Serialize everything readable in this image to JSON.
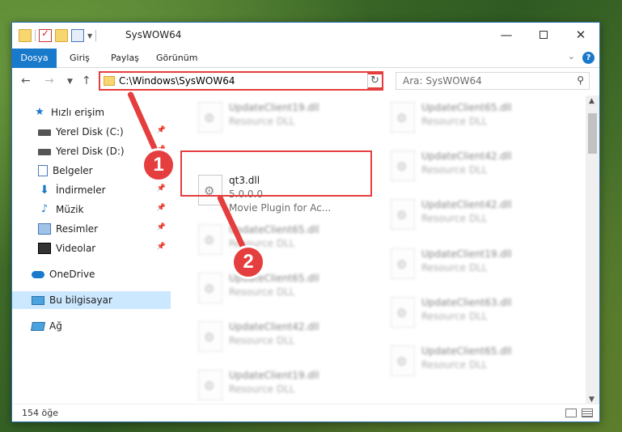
{
  "titlebar": {
    "title": "SysWOW64"
  },
  "ribbon": {
    "tabs": [
      "Dosya",
      "Giriş",
      "Paylaş",
      "Görünüm"
    ]
  },
  "address": {
    "path": "C:\\Windows\\SysWOW64",
    "search_placeholder": "Ara: SysWOW64"
  },
  "sidebar": {
    "items": [
      {
        "label": "Hızlı erişim",
        "icon": "star-icon"
      },
      {
        "label": "Yerel Disk (C:)",
        "icon": "drive-icon"
      },
      {
        "label": "Yerel Disk (D:)",
        "icon": "drive-icon"
      },
      {
        "label": "Belgeler",
        "icon": "documents-icon"
      },
      {
        "label": "İndirmeler",
        "icon": "downloads-icon"
      },
      {
        "label": "Müzik",
        "icon": "music-icon"
      },
      {
        "label": "Resimler",
        "icon": "pictures-icon"
      },
      {
        "label": "Videolar",
        "icon": "videos-icon"
      },
      {
        "label": "OneDrive",
        "icon": "onedrive-icon"
      },
      {
        "label": "Bu bilgisayar",
        "icon": "computer-icon"
      },
      {
        "label": "Ağ",
        "icon": "network-icon"
      }
    ]
  },
  "files": {
    "left": [
      {
        "name": "UpdateClient19.dll",
        "desc": "Resource DLL"
      },
      {
        "name": "UpdateClient65.dll",
        "desc": "Resource DLL"
      },
      {
        "name": "UpdateClient65.dll",
        "desc": "Resource DLL"
      },
      {
        "name": "UpdateClient42.dll",
        "desc": "Resource DLL"
      },
      {
        "name": "UpdateClient19.dll",
        "desc": "Resource DLL"
      }
    ],
    "right": [
      {
        "name": "UpdateClient65.dll",
        "desc": "Resource DLL"
      },
      {
        "name": "UpdateClient42.dll",
        "desc": "Resource DLL"
      },
      {
        "name": "UpdateClient42.dll",
        "desc": "Resource DLL"
      },
      {
        "name": "UpdateClient19.dll",
        "desc": "Resource DLL"
      },
      {
        "name": "UpdateClient63.dll",
        "desc": "Resource DLL"
      },
      {
        "name": "UpdateClient65.dll",
        "desc": "Resource DLL"
      }
    ],
    "highlighted": {
      "name": "qt3.dll",
      "version": "5.0.0.0",
      "desc": "Movie Plugin for Ac..."
    }
  },
  "status": {
    "count": "154 öğe"
  },
  "callouts": [
    "1",
    "2"
  ],
  "colors": {
    "accent": "#1979ca",
    "highlight": "#e53e3e"
  }
}
